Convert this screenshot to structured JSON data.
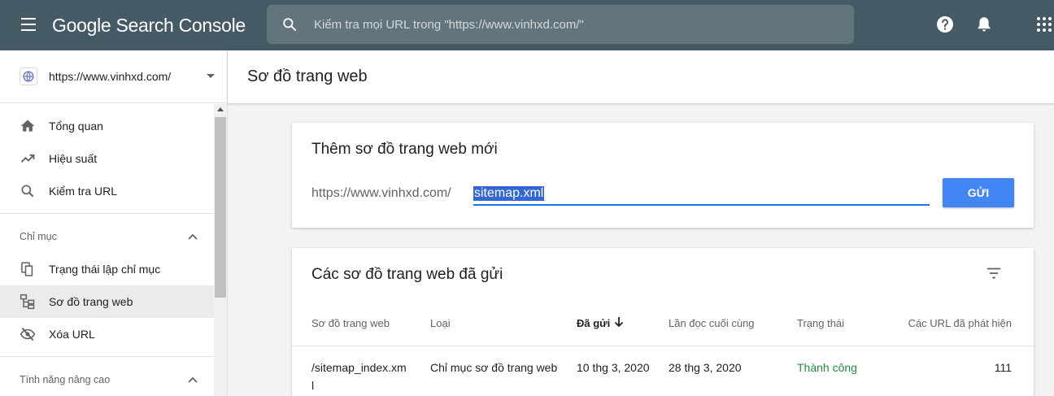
{
  "header": {
    "logo": "Google Search Console",
    "search_placeholder": "Kiểm tra mọi URL trong \"https://www.vinhxd.com/\"",
    "icons": [
      "menu-icon",
      "search-icon",
      "help-icon",
      "bell-icon",
      "apps-icon"
    ]
  },
  "sidebar": {
    "property": "https://www.vinhxd.com/",
    "items": [
      {
        "label": "Tổng quan",
        "icon": "home-icon"
      },
      {
        "label": "Hiệu suất",
        "icon": "trending-up-icon"
      },
      {
        "label": "Kiểm tra URL",
        "icon": "search-icon"
      }
    ],
    "section_index": "Chỉ mục",
    "index_items": [
      {
        "label": "Trạng thái lập chỉ mục",
        "icon": "copy-icon"
      },
      {
        "label": "Sơ đồ trang web",
        "icon": "sitemap-icon",
        "active": true
      },
      {
        "label": "Xóa URL",
        "icon": "eye-off-icon"
      }
    ],
    "section_advanced": "Tính năng nâng cao"
  },
  "page": {
    "title": "Sơ đồ trang web"
  },
  "add_card": {
    "title": "Thêm sơ đồ trang web mới",
    "prefix": "https://www.vinhxd.com/",
    "input_value": "sitemap.xml",
    "submit_label": "GỬI"
  },
  "submitted_card": {
    "title": "Các sơ đồ trang web đã gửi",
    "columns": [
      "Sơ đồ trang web",
      "Loại",
      "Đã gửi",
      "Lần đọc cuối cùng",
      "Trạng thái",
      "Các URL đã phát hiện"
    ],
    "rows": [
      {
        "sitemap": "/sitemap_index.xml",
        "sitemap_line1": "/sitemap_index.xm",
        "sitemap_line2": "l",
        "type": "Chỉ mục sơ đồ trang web",
        "submitted": "10 thg 3, 2020",
        "last_read": "28 thg 3, 2020",
        "status": "Thành công",
        "urls": "111"
      }
    ]
  },
  "colors": {
    "header_bg": "#455a64",
    "accent": "#4285f4",
    "success": "#1e8e3e"
  }
}
